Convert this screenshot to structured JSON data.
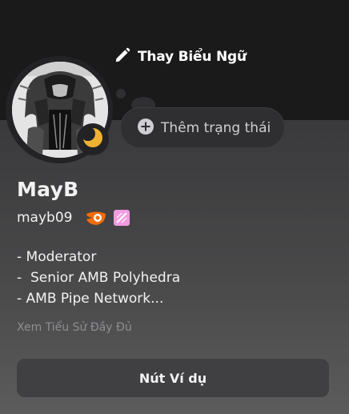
{
  "banner": {
    "change_banner_label": "Thay Biểu Ngữ",
    "icon": "pencil-icon"
  },
  "avatar": {
    "presence_icon": "moon-idle-icon"
  },
  "status": {
    "add_status_label": "Thêm trạng thái",
    "icon": "plus-circle-icon"
  },
  "profile": {
    "display_name": "MayB",
    "username": "mayb09",
    "badges": [
      "hypesquad-brilliance-icon",
      "nitro-badge-icon"
    ],
    "bio_lines": [
      "- Moderator",
      "-  Senior AMB Polyhedra",
      "- AMB Pipe Network..."
    ],
    "full_bio_link": "Xem Tiểu Sử Đầy Đủ"
  },
  "actions": {
    "example_button": "Nút Ví dụ"
  },
  "colors": {
    "banner": "#1a1a1b",
    "accent_orange": "#f26c0c",
    "nitro_pink": "#f29be0",
    "idle_yellow": "#f0b232"
  }
}
